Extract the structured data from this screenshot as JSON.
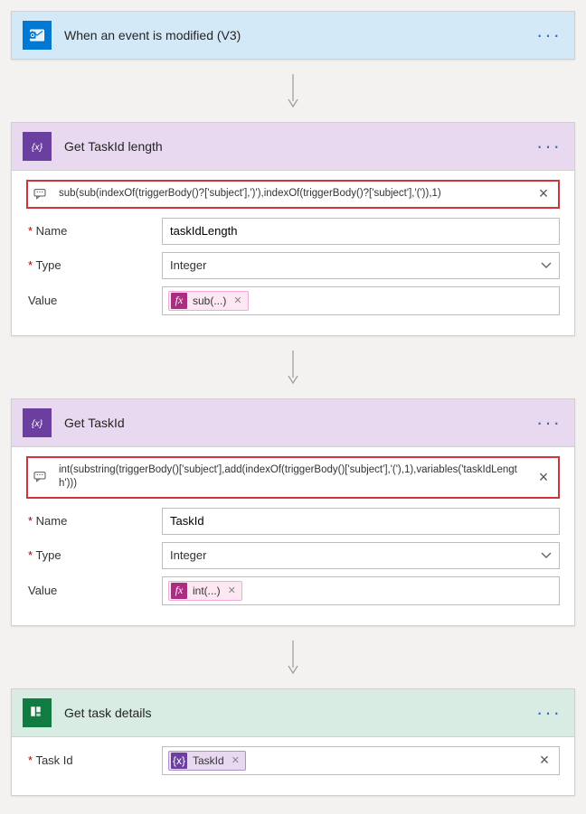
{
  "step1": {
    "title": "When an event is modified (V3)"
  },
  "step2": {
    "title": "Get TaskId length",
    "expression": "sub(sub(indexOf(triggerBody()?['subject'],')'),indexOf(triggerBody()?['subject'],'(')),1)",
    "fields": {
      "nameLabel": "Name",
      "nameValue": "taskIdLength",
      "typeLabel": "Type",
      "typeValue": "Integer",
      "valueLabel": "Value",
      "valuePill": "sub(...)"
    }
  },
  "step3": {
    "title": "Get TaskId",
    "expression": "int(substring(triggerBody()['subject'],add(indexOf(triggerBody()['subject'],'('),1),variables('taskIdLength')))",
    "fields": {
      "nameLabel": "Name",
      "nameValue": "TaskId",
      "typeLabel": "Type",
      "typeValue": "Integer",
      "valueLabel": "Value",
      "valuePill": "int(...)"
    }
  },
  "step4": {
    "title": "Get task details",
    "fields": {
      "taskIdLabel": "Task Id",
      "taskIdPill": "TaskId"
    }
  },
  "fxGlyph": "fx",
  "varGlyph": "{x}"
}
